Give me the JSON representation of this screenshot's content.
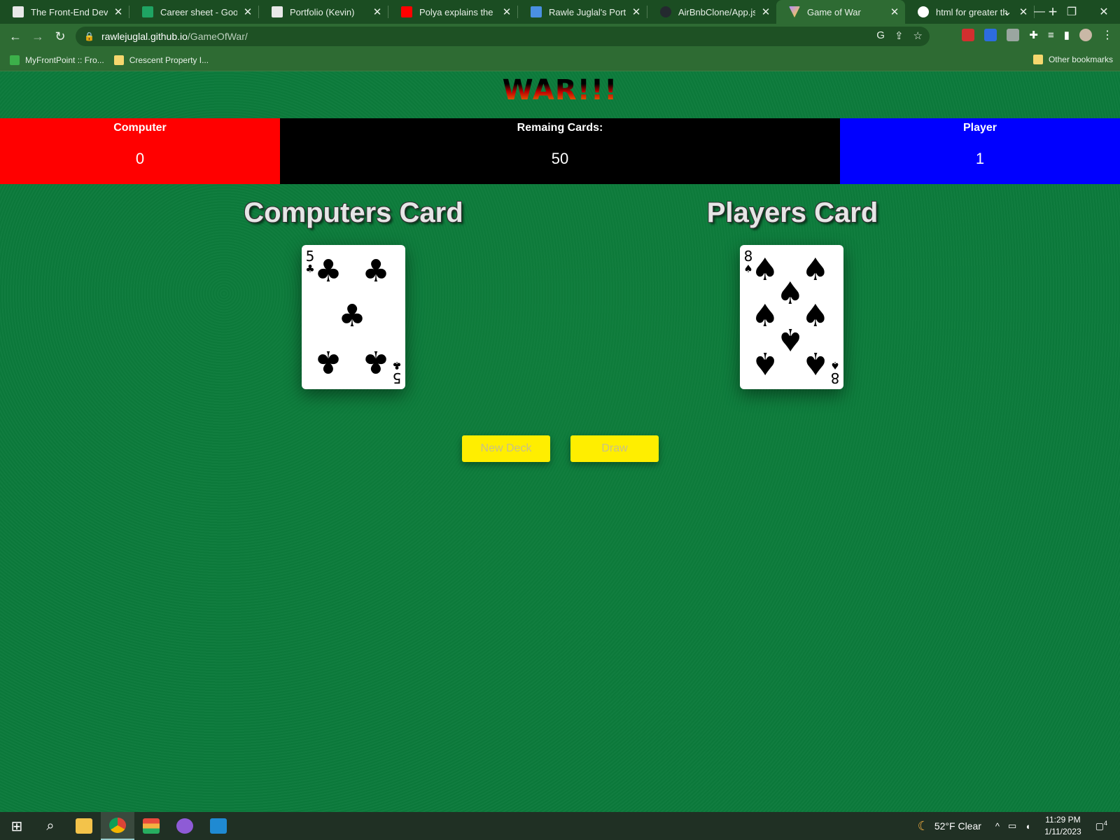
{
  "browser": {
    "tabs": [
      {
        "title": "The Front-End Dev",
        "favicon_color": "#e8e8e8"
      },
      {
        "title": "Career sheet - Goo",
        "favicon_color": "#1fa463"
      },
      {
        "title": "Portfolio (Kevin)",
        "favicon_color": "#e8e8e8"
      },
      {
        "title": "Polya explains the",
        "favicon_color": "#ff0000"
      },
      {
        "title": "Rawle Juglal's Portf",
        "favicon_color": "#4a90e2"
      },
      {
        "title": "AirBnbClone/App.js",
        "favicon_color": "#24292f"
      },
      {
        "title": "Game of War",
        "favicon_color": "#b48cff",
        "active": true
      },
      {
        "title": "html for greater th",
        "favicon_color": "#ffffff"
      }
    ],
    "url_host": "rawlejuglal.github.io",
    "url_path": "/GameOfWar/",
    "bookmarks": [
      {
        "label": "MyFrontPoint :: Fro...",
        "icon_color": "#3cb04a"
      },
      {
        "label": "Crescent Property I...",
        "icon_color": "#f5d76e"
      }
    ],
    "other_bookmarks": "Other bookmarks"
  },
  "game": {
    "title": "WAR!!!",
    "scores": {
      "computer_label": "Computer",
      "computer_value": "0",
      "remaining_label": "Remaing Cards:",
      "remaining_value": "50",
      "player_label": "Player",
      "player_value": "1"
    },
    "computer_heading": "Computers Card",
    "player_heading": "Players Card",
    "computer_card": {
      "rank": "5",
      "suit": "♣",
      "suit_name": "clubs"
    },
    "player_card": {
      "rank": "8",
      "suit": "♠",
      "suit_name": "spades"
    },
    "buttons": {
      "new_deck": "New Deck",
      "draw": "Draw"
    },
    "colors": {
      "computer": "#ff0000",
      "remaining": "#000000",
      "player": "#0000ff",
      "button": "#ffee00",
      "felt": "#0b7a3b"
    }
  },
  "taskbar": {
    "weather": "52°F  Clear",
    "time": "11:29 PM",
    "date": "1/11/2023",
    "notifications": "4"
  }
}
